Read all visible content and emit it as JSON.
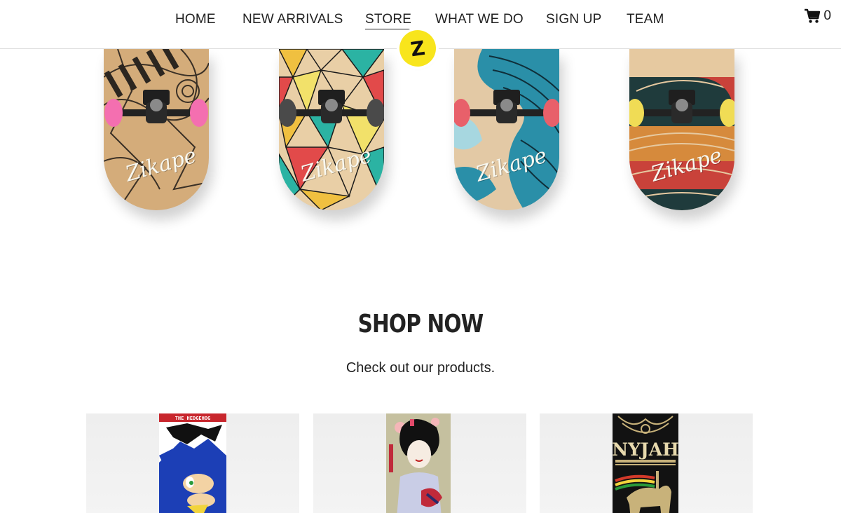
{
  "nav": {
    "items": [
      {
        "label": "HOME",
        "active": false
      },
      {
        "label": "NEW ARRIVALS",
        "active": false
      },
      {
        "label": "STORE",
        "active": true
      },
      {
        "label": "WHAT WE DO",
        "active": false
      },
      {
        "label": "SIGN UP",
        "active": false
      },
      {
        "label": "TEAM",
        "active": false
      }
    ],
    "cart_count": "0",
    "logo_letter": "Z"
  },
  "hero": {
    "boards": [
      {
        "brand": "Zikape",
        "wheel_color": "#f46fb0"
      },
      {
        "brand": "Zikape",
        "wheel_color": "#4a4a4a"
      },
      {
        "brand": "Zikape",
        "wheel_color": "#e8606a"
      },
      {
        "brand": "Zikape",
        "wheel_color": "#f0dc55"
      }
    ]
  },
  "shop": {
    "title": "SHOP NOW",
    "subtitle": "Check out our products."
  },
  "products": [
    {
      "deck_caption": "THE HEDGEHOG"
    },
    {
      "deck_caption": ""
    },
    {
      "deck_caption": "NYJAH"
    }
  ],
  "colors": {
    "logo_yellow": "#f8e51c",
    "text": "#222222"
  }
}
